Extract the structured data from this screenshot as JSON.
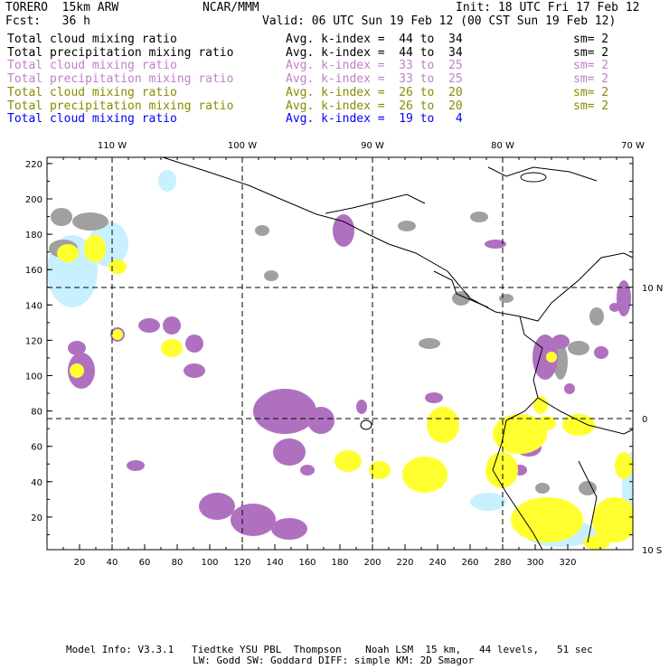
{
  "header": {
    "model": "TORERO  15km ARW",
    "org": "NCAR/MMM",
    "init": "Init: 18 UTC Fri 17 Feb 12",
    "fcst": "Fcst:   36 h",
    "valid": "Valid: 06 UTC Sun 19 Feb 12 (00 CST Sun 19 Feb 12)"
  },
  "legend": [
    {
      "field": "Total cloud mixing ratio",
      "range": "Avg. k-index =  44 to  34",
      "sm": "sm= 2",
      "color": "#000000"
    },
    {
      "field": "Total precipitation mixing ratio",
      "range": "Avg. k-index =  44 to  34",
      "sm": "sm= 2",
      "color": "#000000"
    },
    {
      "field": "Total cloud mixing ratio",
      "range": "Avg. k-index =  33 to  25",
      "sm": "sm= 2",
      "color": "#c080c8"
    },
    {
      "field": "Total precipitation mixing ratio",
      "range": "Avg. k-index =  33 to  25",
      "sm": "sm= 2",
      "color": "#c080c8"
    },
    {
      "field": "Total cloud mixing ratio",
      "range": "Avg. k-index =  26 to  20",
      "sm": "sm= 2",
      "color": "#8a8a00"
    },
    {
      "field": "Total precipitation mixing ratio",
      "range": "Avg. k-index =  26 to  20",
      "sm": "sm= 2",
      "color": "#8a8a00"
    },
    {
      "field": "Total cloud mixing ratio",
      "range": "Avg. k-index =  19 to   4",
      "sm": "",
      "color": "#0000ff"
    }
  ],
  "chart_data": {
    "type": "heatmap",
    "title": "TORERO 15km ARW cloud and precipitation mixing ratio by k-index",
    "x_ticks": [
      20,
      40,
      60,
      80,
      100,
      120,
      140,
      160,
      180,
      200,
      220,
      240,
      260,
      280,
      300,
      320
    ],
    "y_ticks": [
      20,
      40,
      60,
      80,
      100,
      120,
      140,
      160,
      180,
      200,
      220
    ],
    "xlim": [
      0,
      360
    ],
    "ylim": [
      0,
      222
    ],
    "lon_labels": [
      "110 W",
      "100 W",
      "90 W",
      "80 W",
      "70 W"
    ],
    "lat_labels": [
      "10 N",
      "0",
      "10 S"
    ],
    "grid": "dashed lat/lon",
    "colors": {
      "gray": "#a0a0a0",
      "purple": "#b070c0",
      "yellow": "#ffff30",
      "lightblue": "#c8f0ff"
    }
  },
  "footer": {
    "line1": "Model Info: V3.3.1   Tiedtke YSU PBL  Thompson    Noah LSM  15 km,   44 levels,   51 sec",
    "line2": "LW: Godd SW: Goddard DIFF: simple KM: 2D Smagor"
  }
}
